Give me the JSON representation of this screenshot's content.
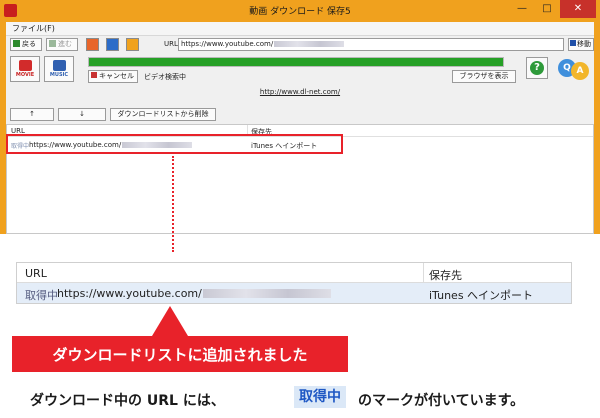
{
  "window": {
    "title": "動画 ダウンロード 保存5",
    "minimize": "—",
    "maximize": "□",
    "close": "✕"
  },
  "menu": {
    "file": "ファイル(F)"
  },
  "toolbar": {
    "back": "戻る",
    "forward": "進む",
    "url_label": "URL",
    "url_value": "https://www.youtube.com/",
    "go": "移動"
  },
  "actions": {
    "movie": "MOVIE",
    "music": "MUSIC",
    "cancel": "キャンセル",
    "status": "ビデオ検索中",
    "show_browser": "ブラウザを表示",
    "help": "?",
    "qa_q": "Q",
    "qa_a": "A",
    "progress": 1.0
  },
  "site_link": "http://www.dl-net.com/",
  "list_controls": {
    "up": "↑",
    "down": "↓",
    "remove": "ダウンロードリストから削除"
  },
  "list": {
    "col_url": "URL",
    "col_dest": "保存先",
    "row": {
      "status": "取得中",
      "url": "https://www.youtube.com/",
      "dest": "iTunes へインポート"
    }
  },
  "zoom": {
    "col_url": "URL",
    "col_dest": "保存先",
    "row": {
      "status": "取得中",
      "url": "https://www.youtube.com/",
      "dest": "iTunes へインポート"
    }
  },
  "callout": "ダウンロードリストに追加されました",
  "caption": {
    "pre": "ダウンロード中の URL には、",
    "badge": "取得中",
    "post": "のマークが付いています。"
  },
  "colors": {
    "titlebar": "#f0a11e",
    "accent_red": "#e8222a",
    "progress_green": "#26a026",
    "badge_blue": "#1f58c4",
    "selected_row": "#e4edf8"
  }
}
